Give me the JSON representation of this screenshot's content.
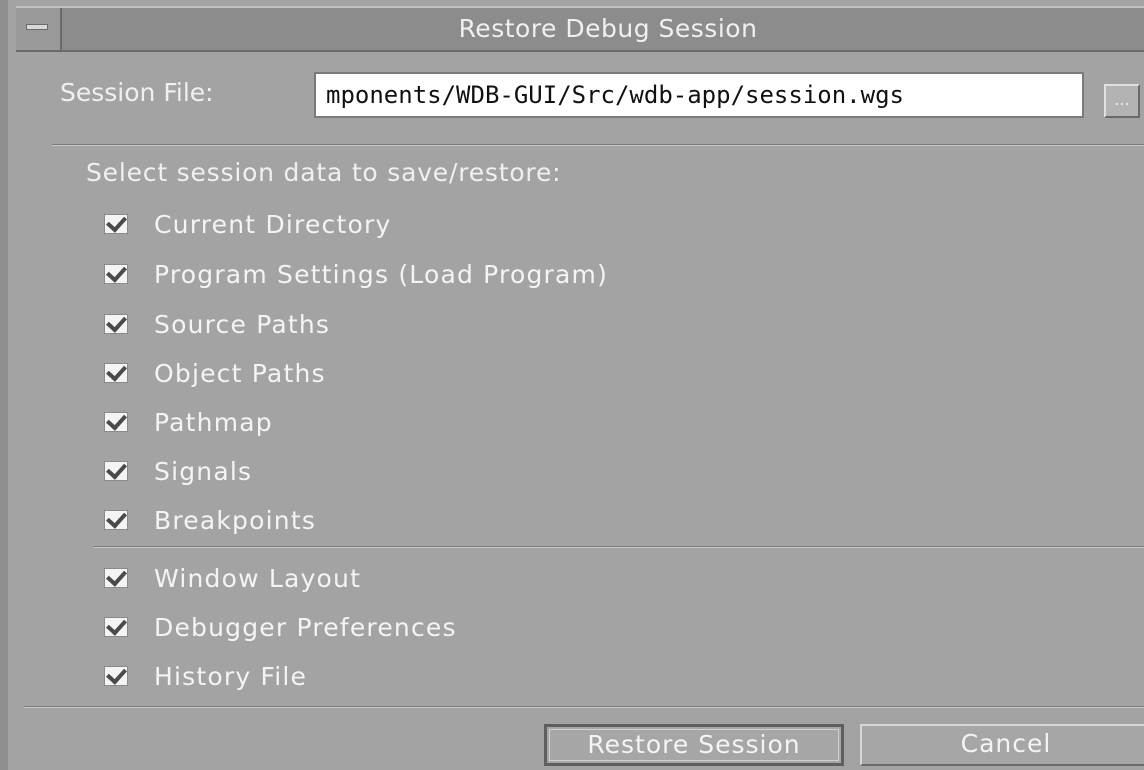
{
  "window": {
    "title": "Restore Debug Session"
  },
  "session": {
    "label": "Session File:",
    "value": "mponents/WDB-GUI/Src/wdb-app/session.wgs",
    "browse_label": "..."
  },
  "options": {
    "header": "Select session data to save/restore:",
    "group1": [
      {
        "label": "Current Directory",
        "checked": true
      },
      {
        "label": "Program Settings (Load Program)",
        "checked": true
      },
      {
        "label": "Source Paths",
        "checked": true
      },
      {
        "label": "Object Paths",
        "checked": true
      },
      {
        "label": "Pathmap",
        "checked": true
      },
      {
        "label": "Signals",
        "checked": true
      },
      {
        "label": "Breakpoints",
        "checked": true
      }
    ],
    "group2": [
      {
        "label": "Window Layout",
        "checked": true
      },
      {
        "label": "Debugger Preferences",
        "checked": true
      },
      {
        "label": "History File",
        "checked": true
      }
    ]
  },
  "buttons": {
    "restore_label": "Restore Session",
    "cancel_label": "Cancel"
  }
}
